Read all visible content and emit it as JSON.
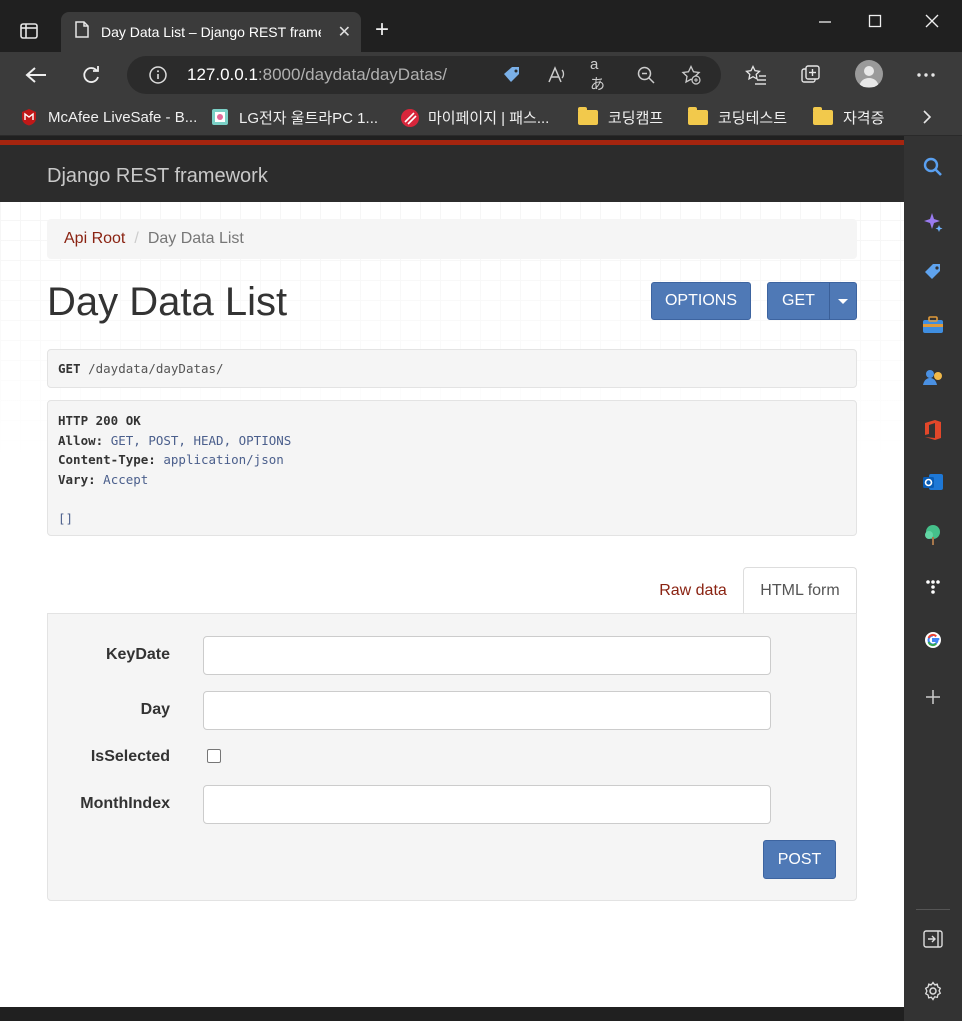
{
  "browser": {
    "tab_title": "Day Data List – Django REST framework",
    "url_host": "127.0.0.1",
    "url_rest": ":8000/daydata/dayDatas/",
    "new_tab": "+",
    "close": "✕"
  },
  "bookmarks": [
    {
      "label": "McAfee LiveSafe - B...",
      "icon": "mcafee-icon"
    },
    {
      "label": "LG전자 울트라PC 1...",
      "icon": "lg-icon"
    },
    {
      "label": "마이페이지 | 패스...",
      "icon": "fastcampus-icon"
    },
    {
      "label": "코딩캠프",
      "icon": "folder-icon"
    },
    {
      "label": "코딩테스트",
      "icon": "folder-icon"
    },
    {
      "label": "자격증",
      "icon": "folder-icon"
    }
  ],
  "page": {
    "brand": "Django REST framework",
    "breadcrumb": {
      "root": "Api Root",
      "sep": "/",
      "current": "Day Data List"
    },
    "title": "Day Data List",
    "buttons": {
      "options": "OPTIONS",
      "get": "GET",
      "post": "POST"
    },
    "request": {
      "method": "GET",
      "path": "/daydata/dayDatas/"
    },
    "response": {
      "status": "HTTP 200 OK",
      "allow_key": "Allow:",
      "allow_val": "GET, POST, HEAD, OPTIONS",
      "ctype_key": "Content-Type:",
      "ctype_val": "application/json",
      "vary_key": "Vary:",
      "vary_val": "Accept",
      "body": "[]"
    },
    "tabs": {
      "raw": "Raw data",
      "html": "HTML form"
    },
    "form": {
      "keydate_label": "KeyDate",
      "keydate_value": "",
      "day_label": "Day",
      "day_value": "",
      "isselected_label": "IsSelected",
      "isselected_checked": false,
      "monthindex_label": "MonthIndex",
      "monthindex_value": ""
    }
  },
  "colors": {
    "accent": "#4f79b6",
    "link": "#8a2312",
    "navbar": "#2c2c2c",
    "navbar_top": "#a5250f"
  }
}
